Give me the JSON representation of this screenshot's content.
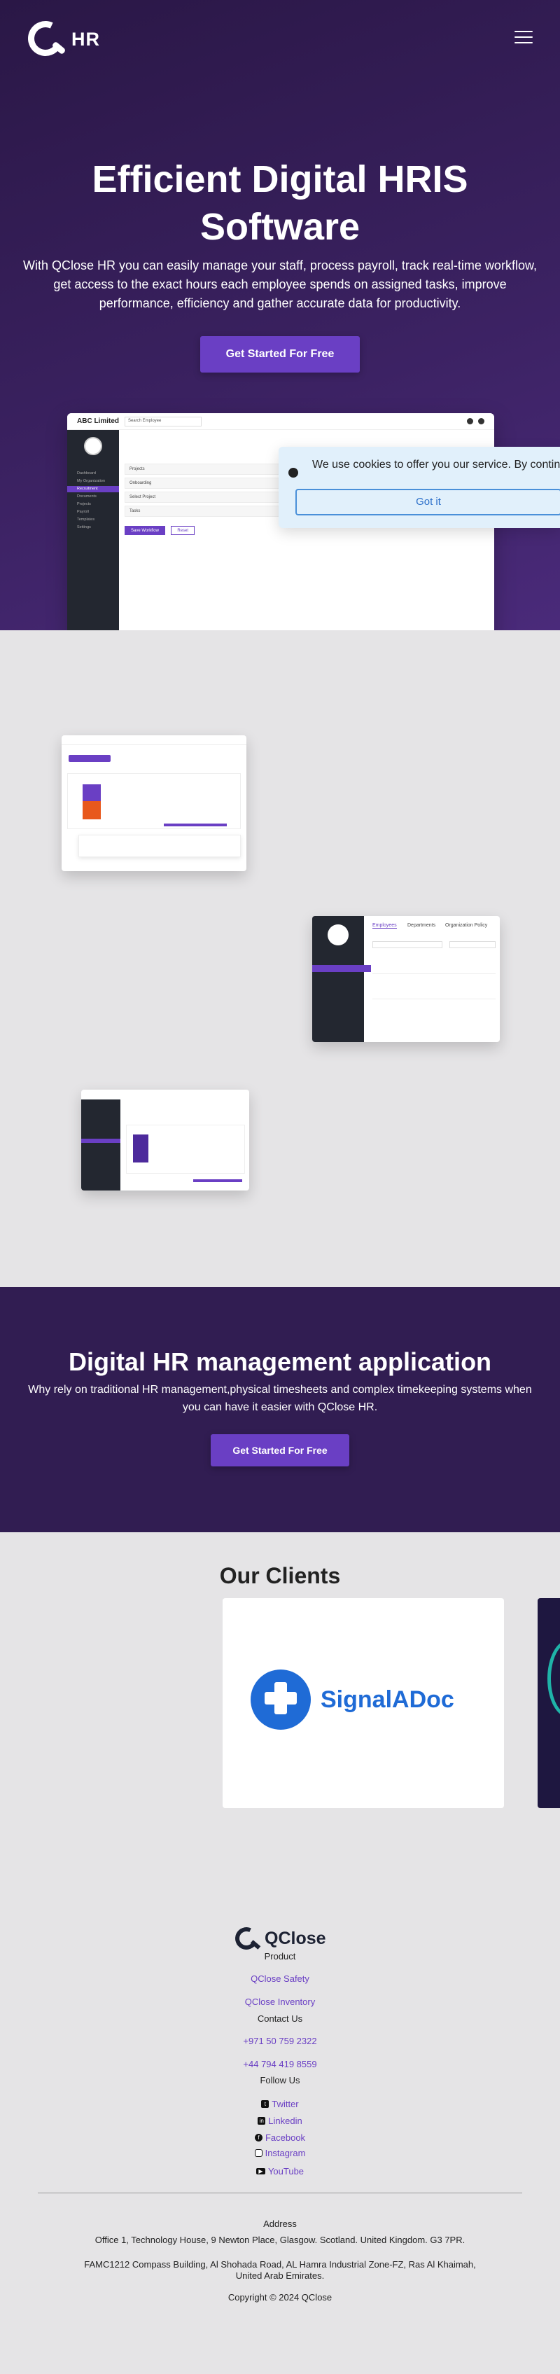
{
  "header": {
    "brand": "HR",
    "menu_icon": "hamburger-icon"
  },
  "hero": {
    "title": "Efficient Digital HRIS Software",
    "subtitle": "With QClose HR you can easily manage your staff, process payroll, track real-time workflow, get access to the exact hours each employee spends on assigned tasks, improve performance, efficiency and gather accurate data for productivity.",
    "cta": "Get Started For Free"
  },
  "mock_screen": {
    "company": "ABC Limited",
    "search_placeholder": "Search Employee",
    "nav": [
      "Dashboard",
      "My Organization",
      "Recruitment",
      "Documents",
      "Projects",
      "Payroll",
      "Templates",
      "Settings"
    ],
    "rows": [
      "Projects",
      "Onboarding",
      "Select Project",
      "Tasks"
    ],
    "buttons": [
      "Save Workflow",
      "Reset"
    ]
  },
  "cookie": {
    "message": "We use cookies to offer you our service. By continuing, you consent to our use of cookies as described in",
    "button": "Got it"
  },
  "gallery_tabs": [
    "Employees",
    "Departments",
    "Organization Policy"
  ],
  "cta_section": {
    "title": "Digital HR management application",
    "subtitle": "Why rely on traditional HR management,physical timesheets and complex timekeeping systems when you can have it easier with QClose HR.",
    "cta": "Get Started For Free"
  },
  "clients": {
    "title": "Our Clients",
    "client_name": "SignalADoc"
  },
  "footer": {
    "brand": "QClose",
    "product_heading": "Product",
    "product_links": [
      "QClose Safety",
      "QClose Inventory"
    ],
    "contact_heading": "Contact Us",
    "phones": [
      "+971 50 759 2322",
      "+44 794 419 8559"
    ],
    "follow_heading": "Follow Us",
    "social": [
      "Twitter",
      "Linkedin",
      "Facebook",
      "Instagram",
      "YouTube"
    ],
    "address_heading": "Address",
    "address_1": "Office 1, Technology House, 9 Newton Place, Glasgow. Scotland. United Kingdom. G3 7PR.",
    "address_2": "FAMC1212 Compass Building, Al Shohada Road, AL Hamra Industrial Zone-FZ, Ras Al Khaimah, United Arab Emirates.",
    "copyright": "Copyright © 2024 QClose"
  },
  "colors": {
    "hero_bg": "#3a2160",
    "accent": "#6a3fc4",
    "cta_bg": "#311d52",
    "page_bg": "#e5e4e6"
  }
}
